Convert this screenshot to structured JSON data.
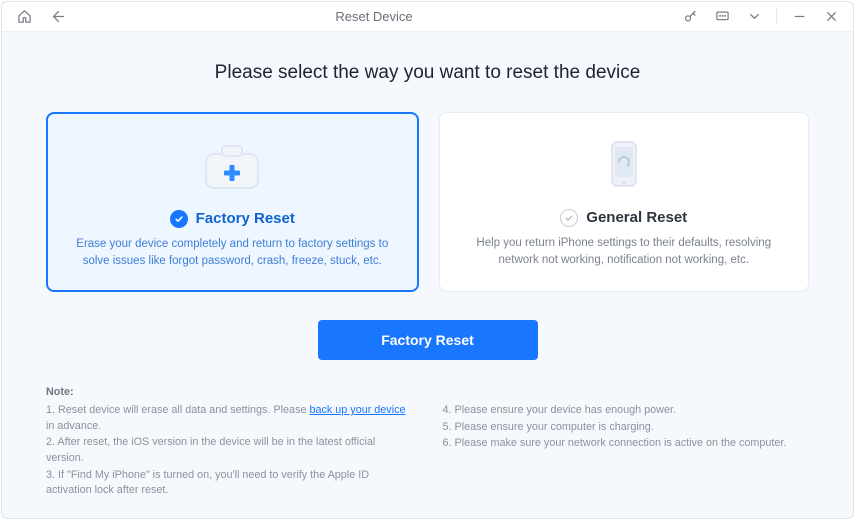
{
  "window": {
    "title": "Reset Device"
  },
  "heading": "Please select the way you want to reset the device",
  "cards": {
    "factory": {
      "title": "Factory Reset",
      "desc": "Erase your device completely and return to factory settings to solve issues like forgot password, crash, freeze, stuck, etc."
    },
    "general": {
      "title": "General Reset",
      "desc": "Help you return iPhone settings to their defaults, resolving network not working, notification not working, etc."
    }
  },
  "action_button": "Factory Reset",
  "notes": {
    "title": "Note:",
    "left": {
      "l1a": "1. Reset device will erase all data and settings. Please ",
      "l1b": "back up your device",
      "l1c": " in advance.",
      "l2": "2. After reset, the iOS version in the device will be in the latest official version.",
      "l3": "3. If \"Find My iPhone\" is turned on, you'll need to verify the Apple ID activation lock after reset."
    },
    "right": {
      "l4": "4. Please ensure your device has enough power.",
      "l5": "5. Please ensure your computer is charging.",
      "l6": "6. Please make sure your network connection is active on the computer."
    }
  }
}
